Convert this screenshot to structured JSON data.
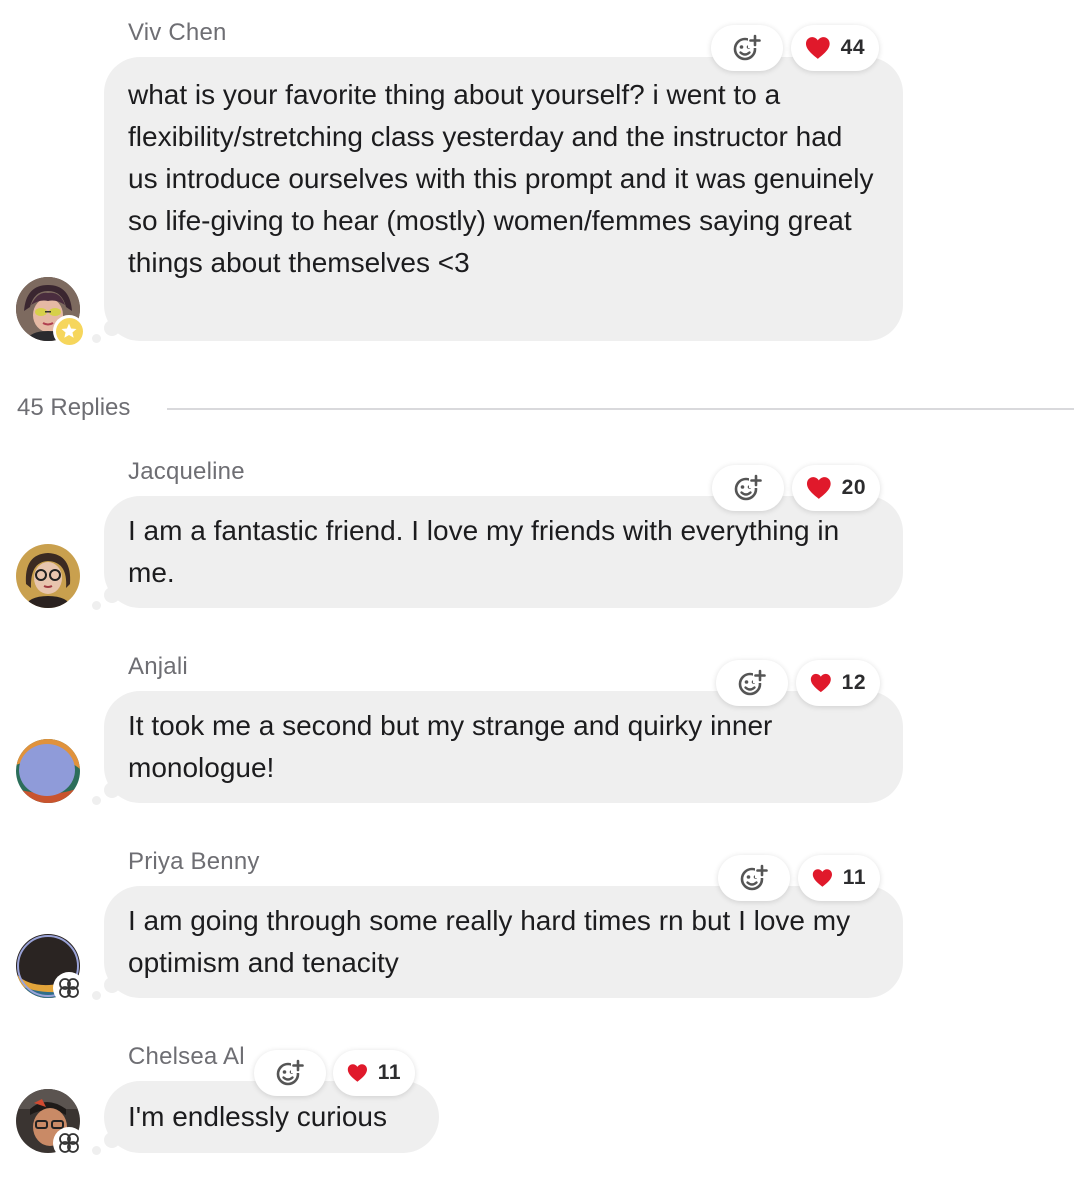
{
  "post": {
    "author": "Viv Chen",
    "text": "what is your favorite thing about yourself? i went to a flexibility/stretching class yesterday and the instructor had us introduce ourselves with this prompt and it was genuinely so life-giving to hear (mostly) women/femmes saying great things about themselves <3",
    "heart_count": "44",
    "author_badge_icon": "star-icon"
  },
  "replies_label": "45 Replies",
  "replies": [
    {
      "author": "Jacqueline",
      "text": "I am a fantastic friend. I love my friends with everything in me.",
      "heart_count": "20"
    },
    {
      "author": "Anjali",
      "text": "It took me a second but my strange and quirky inner monologue!",
      "heart_count": "12"
    },
    {
      "author": "Priya Benny",
      "text": "I am going through some really hard times rn but I love my optimism and tenacity",
      "heart_count": "11",
      "author_badge_icon": "flower-icon"
    },
    {
      "author": "Chelsea Al",
      "text": "I'm endlessly curious",
      "heart_count": "11",
      "author_badge_icon": "flower-icon"
    }
  ],
  "colors": {
    "bubble": "#efefef",
    "author_text": "#6e6e73",
    "heart": "#e0192b",
    "star_badge": "#f6d65c"
  }
}
